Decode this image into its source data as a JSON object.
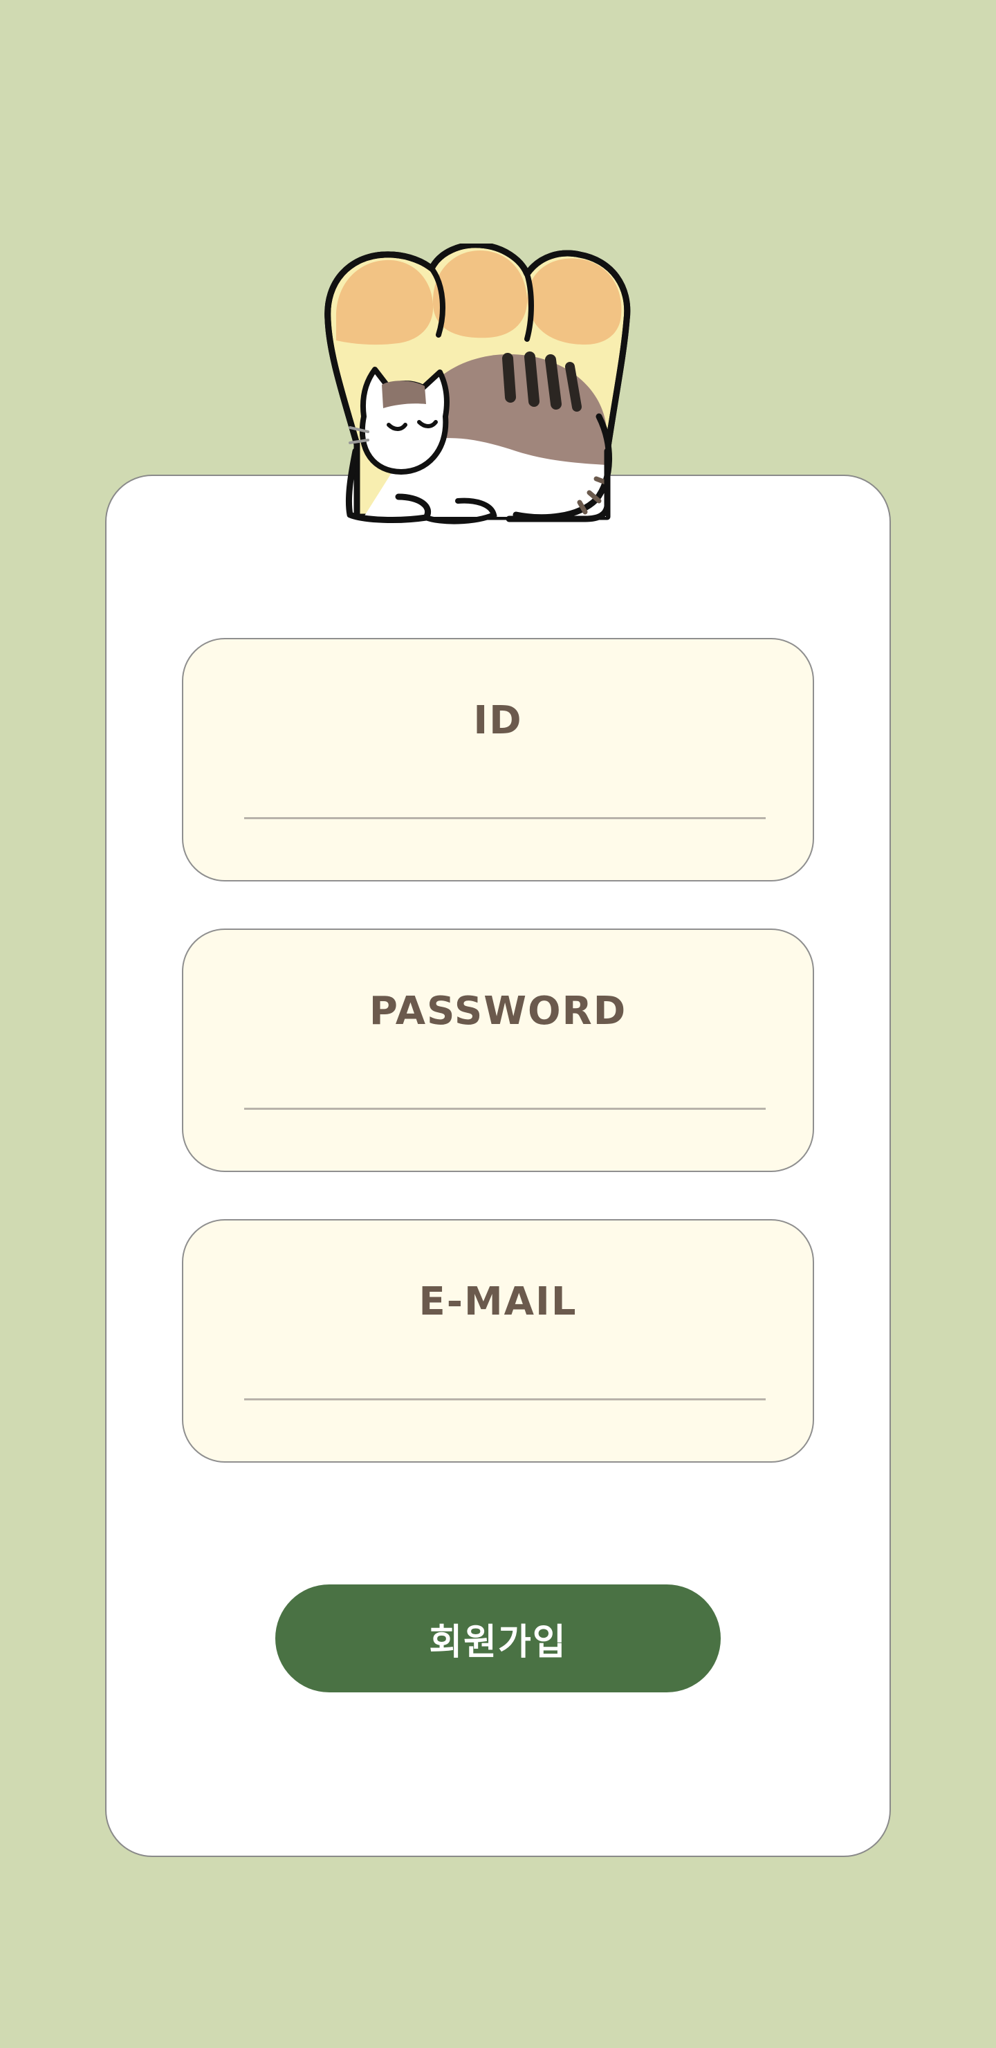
{
  "colors": {
    "background": "#d0dab2",
    "card": "#ffffff",
    "field_bg": "#fffbea",
    "label_text": "#6b5a4d",
    "button_bg": "#4a7244",
    "button_text": "#ffffff"
  },
  "mascot": {
    "icon": "cat-in-bread-icon"
  },
  "form": {
    "fields": [
      {
        "label": "ID",
        "value": "",
        "placeholder": ""
      },
      {
        "label": "PASSWORD",
        "value": "",
        "placeholder": ""
      },
      {
        "label": "E-MAIL",
        "value": "",
        "placeholder": ""
      }
    ],
    "submit_label": "회원가입"
  }
}
